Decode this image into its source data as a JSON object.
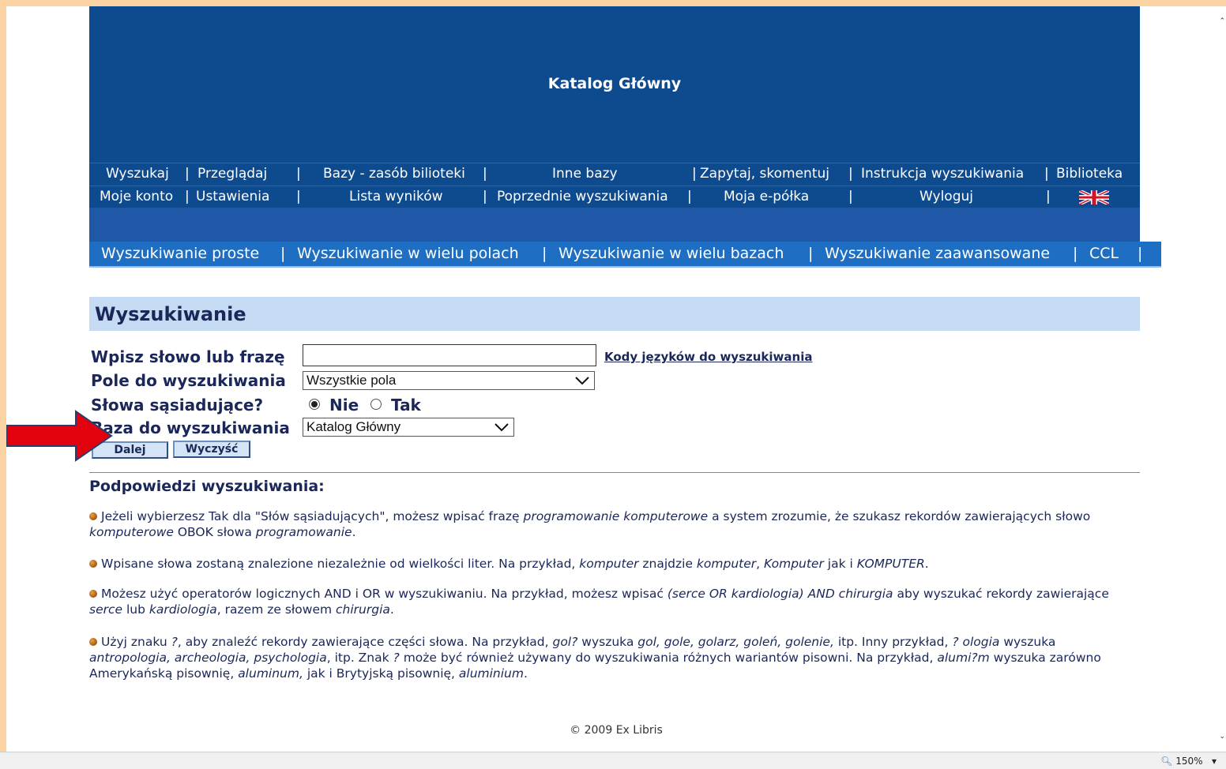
{
  "header": {
    "title": "Katalog Główny"
  },
  "nav_row1": [
    "Wyszukaj",
    "|",
    "Przeglądaj",
    "|",
    "Bazy - zasób bilioteki",
    "|",
    "Inne bazy",
    "|",
    "Zapytaj, skomentuj",
    "|",
    "Instrukcja wyszukiwania",
    "|",
    "Biblioteka"
  ],
  "nav_row2": [
    "Moje konto",
    "|",
    "Ustawienia",
    "|",
    "Lista wyników",
    "|",
    "Poprzednie wyszukiwania",
    "|",
    "Moja e-półka",
    "|",
    "Wyloguj",
    "|"
  ],
  "tabs": [
    "Wyszukiwanie proste",
    "|",
    "Wyszukiwanie w wielu polach",
    "|",
    "Wyszukiwanie w wielu bazach",
    "|",
    "Wyszukiwanie zaawansowane",
    "|",
    "CCL",
    "|"
  ],
  "section": {
    "title": "Wyszukiwanie"
  },
  "form": {
    "phrase_label": "Wpisz słowo lub frazę",
    "phrase_value": "",
    "codes_link": "Kody języków do wyszukiwania",
    "field_label": "Pole do wyszukiwania",
    "field_selected": "Wszystkie pola",
    "adjacent_label": "Słowa sąsiadujące?",
    "adjacent_no": "Nie",
    "adjacent_yes": "Tak",
    "adjacent_selected": "Nie",
    "base_label": "Baza do wyszukiwania",
    "base_selected": "Katalog Główny",
    "submit": "Dalej",
    "clear": "Wyczyść"
  },
  "hints": {
    "title": "Podpowiedzi wyszukiwania:",
    "h1": {
      "a": "Jeżeli wybierzesz Tak dla \"Słów sąsiadujących\", możesz wpisać frazę ",
      "b": "programowanie komputerowe",
      "c": " a system zrozumie, że szukasz rekordów zawierających słowo ",
      "d": "komputerowe",
      "e": " OBOK słowa ",
      "f": "programowanie",
      "g": "."
    },
    "h2": {
      "a": "Wpisane słowa zostaną znalezione niezależnie od wielkości liter. Na przykład, ",
      "b": "komputer",
      "c": " znajdzie ",
      "d": "komputer",
      "e": ", ",
      "f": "Komputer",
      "g": " jak i ",
      "h": "KOMPUTER",
      "i": "."
    },
    "h3": {
      "a": "Możesz użyć operatorów logicznych AND i OR w wyszukiwaniu. Na przykład, możesz wpisać ",
      "b": "(serce OR kardiologia) AND chirurgia",
      "c": " aby wyszukać rekordy zawierające ",
      "d": "serce",
      "e": " lub ",
      "f": "kardiologia",
      "g": ", razem ze słowem ",
      "h": "chirurgia",
      "i": "."
    },
    "h4": {
      "a": "Użyj znaku ",
      "b": "?",
      "c": ", aby znaleźć rekordy zawierające części słowa. Na przykład, ",
      "d": "gol?",
      "e": " wyszuka ",
      "f": "gol, gole, golarz, goleń, golenie,",
      "g": " itp. Inny przykład, ",
      "h": "? ologia",
      "i": " wyszuka ",
      "j": "antropologia, archeologia, psychologia",
      "k": ", itp. Znak ",
      "l": "?",
      "m": " może być również używany do wyszukiwania różnych wariantów pisowni. Na przykład, ",
      "n": "alumi?m",
      "o": " wyszuka zarówno Amerykańską pisownię, ",
      "p": "aluminum,",
      "q": " jak i Brytyjską pisownię, ",
      "r": "aluminium",
      "s": "."
    }
  },
  "footer": "© 2009 Ex Libris",
  "statusbar": {
    "zoom": "150%"
  },
  "colors": {
    "header_bg": "#0e4a8e",
    "tab_bg": "#1e6fc4",
    "section_bg": "#c5daf3",
    "text": "#1a2758",
    "page_border": "#fcd3a3",
    "arrow": "#e3000f"
  },
  "icons": [
    "uk-flag-icon",
    "chevron-down-icon",
    "bullet-icon",
    "red-arrow-annotation",
    "magnifier-icon"
  ]
}
